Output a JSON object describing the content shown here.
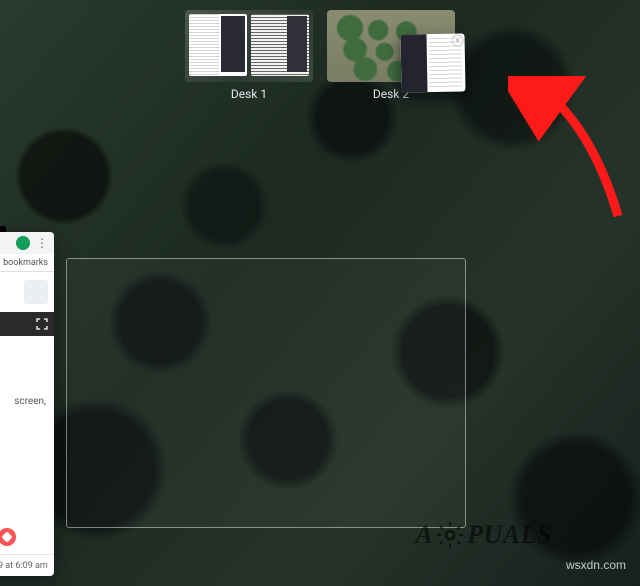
{
  "desks": [
    {
      "label": "Desk 1"
    },
    {
      "label": "Desk 2"
    }
  ],
  "dragged_window": {
    "close_glyph": "×"
  },
  "left_window": {
    "bookmarks_text": "bookmarks",
    "body_hint": "screen,",
    "footer_text": "9 at 6:09 am"
  },
  "watermark": {
    "brand_prefix": "A",
    "brand_suffix": "PUALS",
    "url": "wsxdn.com"
  }
}
